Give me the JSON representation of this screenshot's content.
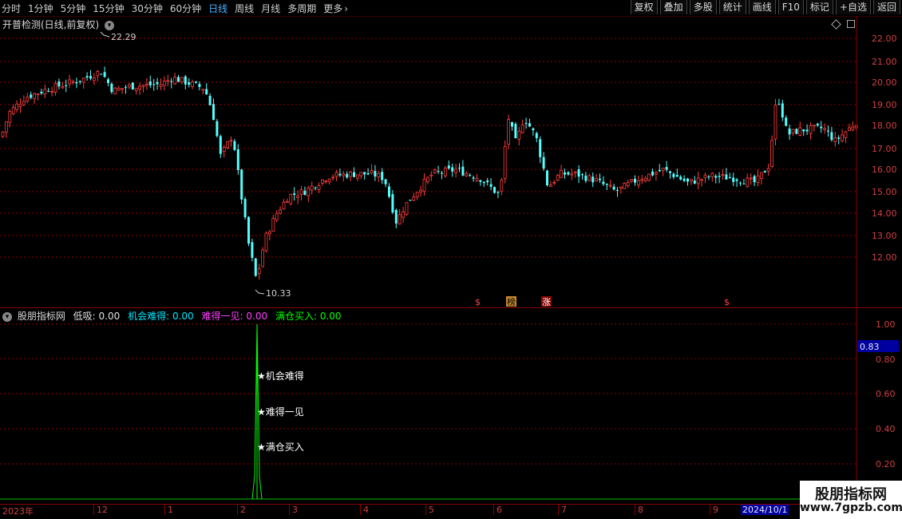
{
  "toolbar": {
    "periods": [
      "分时",
      "1分钟",
      "5分钟",
      "15分钟",
      "30分钟",
      "60分钟",
      "日线",
      "周线",
      "月线",
      "多周期",
      "更多"
    ],
    "active_period": "日线",
    "more_icon": "chevron-right-icon",
    "right_buttons": [
      "复权",
      "叠加",
      "多股",
      "统计",
      "画线",
      "F10",
      "标记",
      "+自选",
      "返回"
    ]
  },
  "main_panel": {
    "title": "开普检测(日线,前复权)",
    "title_icon": "chevron-down-icon",
    "corner_icons": [
      "diamond-icon",
      "square-icon"
    ],
    "price_axis": [
      "22.00",
      "21.00",
      "20.00",
      "19.00",
      "18.00",
      "17.00",
      "16.00",
      "15.00",
      "14.00",
      "13.00",
      "12.00"
    ],
    "high_label": "22.29",
    "low_label": "10.33",
    "markers": [
      "$",
      "榜",
      "涨",
      "$"
    ]
  },
  "indicator_panel": {
    "icon": "chevron-down-icon",
    "name": "股朋指标网",
    "items": [
      {
        "label": "低吸:",
        "value": "0.00",
        "color": "#e0e0e0"
      },
      {
        "label": "机会难得:",
        "value": "0.00",
        "color": "#00e5ff"
      },
      {
        "label": "难得一见:",
        "value": "0.00",
        "color": "#ff40ff"
      },
      {
        "label": "满仓买入:",
        "value": "0.00",
        "color": "#00ff00"
      }
    ],
    "axis": [
      "1.00",
      "0.80",
      "0.60",
      "0.40",
      "0.20"
    ],
    "cursor_value": "0.83",
    "signal_labels": [
      "★机会难得",
      "★难得一见",
      "★满仓买入"
    ]
  },
  "date_axis": [
    "2023年",
    "12",
    "1",
    "2",
    "3",
    "4",
    "5",
    "6",
    "7",
    "8",
    "9",
    "2024/10/1"
  ],
  "watermark": {
    "line1": "股朋指标网",
    "line2": "www.7gpzb.com"
  },
  "colors": {
    "up": "#ff3c3c",
    "down": "#54ffff",
    "grid": "#8b0000",
    "signal": "#00ff00"
  }
}
